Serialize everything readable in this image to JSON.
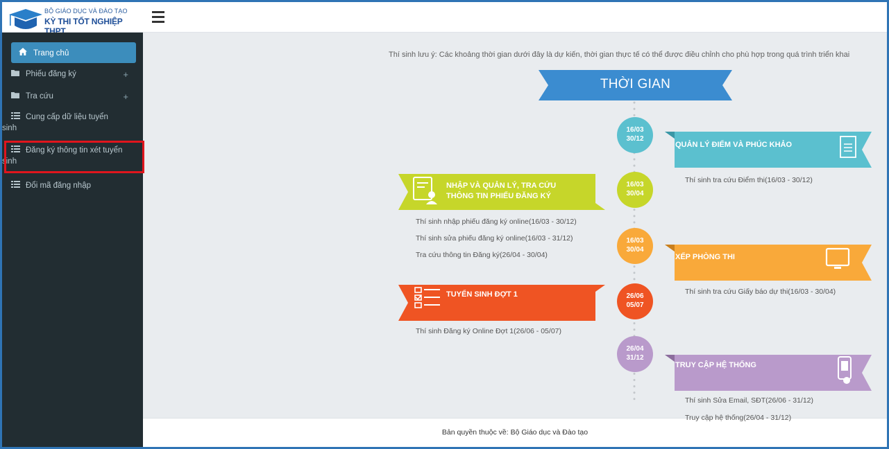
{
  "brand": {
    "line1": "BỘ GIÁO DỤC VÀ ĐÀO TẠO",
    "line2": "KỲ THI TỐT NGHIỆP THPT",
    "logo_icon": "graduation-cap-icon"
  },
  "sidebar": {
    "items": [
      {
        "label": "Trang chủ",
        "icon": "home-icon",
        "active": true
      },
      {
        "label": "Phiếu đăng ký",
        "icon": "folder-icon",
        "expand": "+"
      },
      {
        "label": "Tra cứu",
        "icon": "folder-icon",
        "expand": "+"
      },
      {
        "label_line1": "Cung cấp dữ liệu tuyển",
        "label_line2": "sinh",
        "icon": "list-icon"
      },
      {
        "label_line1": "Đăng ký thông tin xét tuyển",
        "label_line2": "sinh",
        "icon": "list-icon",
        "highlighted": true
      },
      {
        "label": "Đổi mã đăng nhập",
        "icon": "list-icon"
      }
    ]
  },
  "main": {
    "notice": "Thí sinh lưu ý: Các khoảng thời gian dưới đây là dự kiến, thời gian thực tế có thể được điều chỉnh cho phù hợp trong quá trình triển khai",
    "timeline_title": "THỜI GIAN",
    "circles": [
      {
        "d1": "16/03",
        "d2": "30/12",
        "color": "#5bc0cf"
      },
      {
        "d1": "16/03",
        "d2": "30/04",
        "color": "#c6d62a"
      },
      {
        "d1": "16/03",
        "d2": "30/04",
        "color": "#f9a93a"
      },
      {
        "d1": "26/06",
        "d2": "05/07",
        "color": "#ef5423"
      },
      {
        "d1": "26/04",
        "d2": "31/12",
        "color": "#b99acb"
      }
    ],
    "ribbons": {
      "diem": {
        "title": "QUẢN LÝ ĐIỂM VÀ PHÚC KHẢO",
        "color": "#5bc0cf",
        "icon": "document-icon",
        "desc": [
          "Thí sinh tra cứu Điểm thi(16/03 - 30/12)"
        ]
      },
      "phieu": {
        "title_line1": "NHẬP VÀ QUẢN LÝ, TRA CỨU",
        "title_line2": "THÔNG TIN PHIẾU ĐĂNG KÝ",
        "color": "#c6d62a",
        "icon": "form-user-icon",
        "desc": [
          "Thí sinh nhập phiếu đăng ký online(16/03 - 30/12)",
          "Thí sinh sửa phiếu đăng ký online(16/03 - 31/12)",
          "Tra cứu thông tin Đăng ký(26/04 - 30/04)"
        ]
      },
      "phong": {
        "title": "XẾP PHÒNG THI",
        "color": "#f9a93a",
        "icon": "monitor-icon",
        "desc": [
          "Thí sinh tra cứu Giấy báo dự thi(16/03 - 30/04)"
        ]
      },
      "tuyensinh": {
        "title": "TUYỂN SINH ĐỢT 1",
        "color": "#ef5423",
        "icon": "checklist-icon",
        "desc": [
          "Thí sinh Đăng ký Online Đợt 1(26/06 - 05/07)"
        ]
      },
      "truycap": {
        "title": "TRUY CẬP HỆ THỐNG",
        "color": "#b99acb",
        "icon": "mobile-icon",
        "desc": [
          "Thí sinh Sửa Email, SĐT(26/06 - 31/12)",
          "Truy cập hệ thống(26/04 - 31/12)"
        ]
      }
    }
  },
  "footer": {
    "text": "Bản quyền thuộc về: Bộ Giáo dục và Đào tạo"
  }
}
